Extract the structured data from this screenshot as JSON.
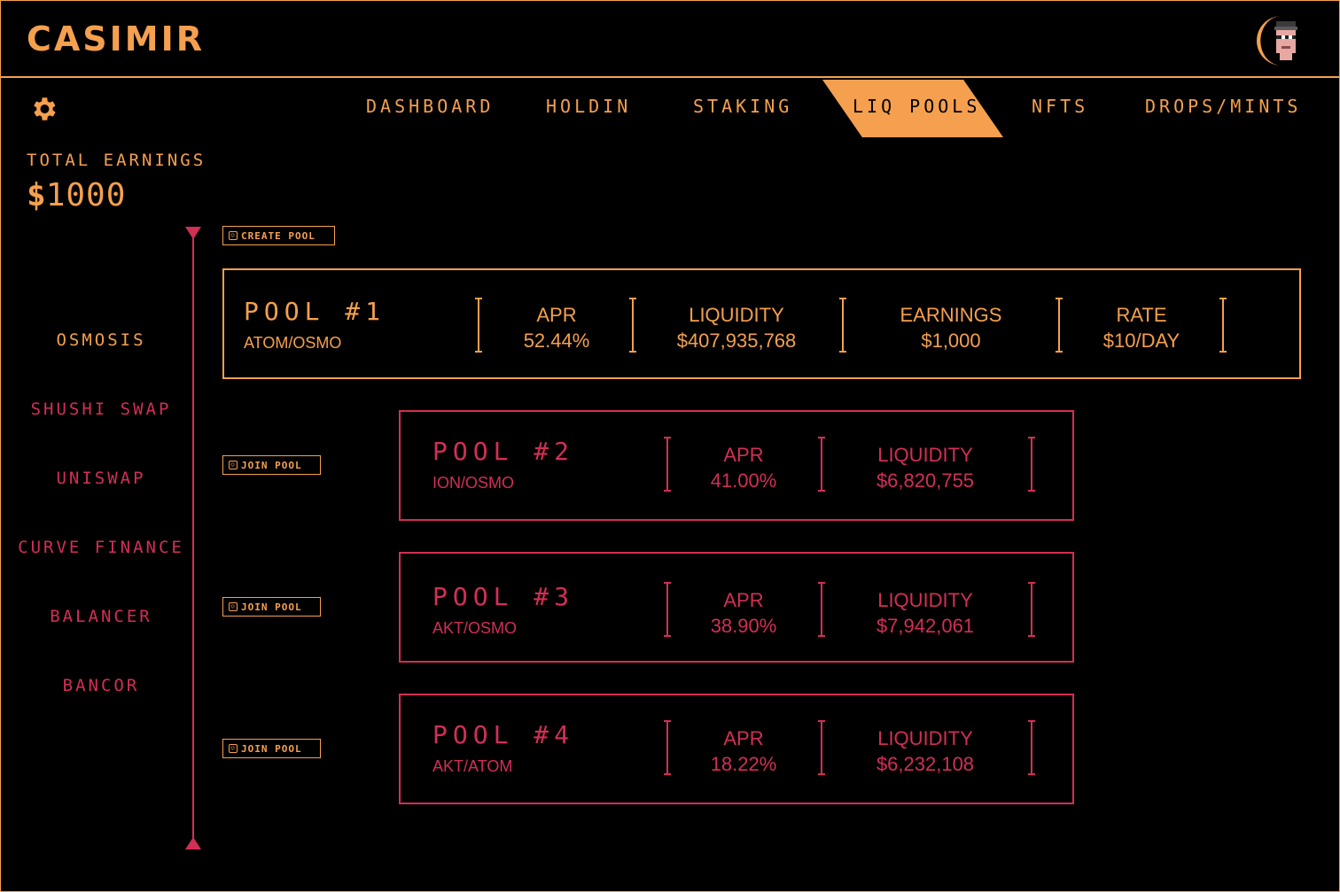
{
  "app": {
    "title": "CASIMIR"
  },
  "icons": {
    "settings": "gear-icon",
    "avatar": "pixel-avatar-icon",
    "button": "square-icon"
  },
  "colors": {
    "primary": "#f5a04e",
    "secondary": "#d22f55",
    "background": "#000000"
  },
  "nav": {
    "items": [
      "DASHBOARD",
      "HOLDIN",
      "STAKING",
      "LIQ POOLS",
      "NFTS",
      "DROPS/MINTS"
    ],
    "active": "LIQ POOLS"
  },
  "earnings": {
    "label": "TOTAL EARNINGS",
    "currency": "$",
    "value": "1000"
  },
  "dexes": {
    "items": [
      "OSMOSIS",
      "SHUSHI SWAP",
      "UNISWAP",
      "CURVE FINANCE",
      "BALANCER",
      "BANCOR"
    ],
    "active": "OSMOSIS"
  },
  "buttons": {
    "create": "CREATE POOL",
    "join": "JOIN POOL"
  },
  "pools": [
    {
      "title": "POOL #1",
      "pair": "ATOM/OSMO",
      "apr_label": "APR",
      "apr": "52.44%",
      "liq_label": "LIQUIDITY",
      "liquidity": "$407,935,768",
      "earn_label": "EARNINGS",
      "earnings": "$1,000",
      "rate_label": "RATE",
      "rate": "$10/DAY"
    },
    {
      "title": "POOL #2",
      "pair": "ION/OSMO",
      "apr_label": "APR",
      "apr": "41.00%",
      "liq_label": "LIQUIDITY",
      "liquidity": "$6,820,755"
    },
    {
      "title": "POOL #3",
      "pair": "AKT/OSMO",
      "apr_label": "APR",
      "apr": "38.90%",
      "liq_label": "LIQUIDITY",
      "liquidity": "$7,942,061"
    },
    {
      "title": "POOL #4",
      "pair": "AKT/ATOM",
      "apr_label": "APR",
      "apr": "18.22%",
      "liq_label": "LIQUIDITY",
      "liquidity": "$6,232,108"
    }
  ]
}
